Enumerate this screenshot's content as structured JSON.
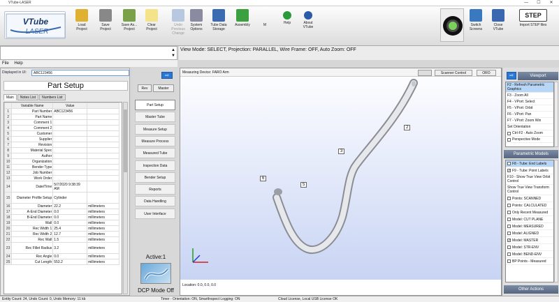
{
  "app": {
    "title": "VTube-LASER",
    "win_min": "—",
    "win_max": "☐",
    "win_close": "✕"
  },
  "logo": {
    "text": "VTube-LASER"
  },
  "toolbar": [
    {
      "label": "Load\nProject",
      "icon": "load-project-icon",
      "color": "#e0b030",
      "enabled": true
    },
    {
      "label": "Save\nProject",
      "icon": "save-project-icon",
      "color": "#888888",
      "enabled": true
    },
    {
      "label": "Save As...\nProject",
      "icon": "save-as-icon",
      "color": "#7aa04a",
      "enabled": true
    },
    {
      "label": "Clear\nProject",
      "icon": "clear-project-icon",
      "color": "#f4e38a",
      "enabled": true
    },
    {
      "label": "Undo\nPrevious\nChange",
      "icon": "undo-icon",
      "color": "#b8c8e0",
      "enabled": false
    },
    {
      "label": "System\nOptions",
      "icon": "gear-icon",
      "color": "#8a8aa0",
      "enabled": true
    },
    {
      "label": "Tube Data\nStorage",
      "icon": "tube-storage-icon",
      "color": "#3a6ab0",
      "enabled": true
    },
    {
      "label": "Assembly",
      "icon": "assembly-icon",
      "color": "#3aa040",
      "enabled": true
    },
    {
      "label": "M",
      "icon": "m-icon",
      "color": "#111111",
      "enabled": true
    },
    {
      "label": "Help",
      "icon": "help-icon",
      "color": "#2a9a3a",
      "enabled": true
    },
    {
      "label": "About\nVTube",
      "icon": "info-icon",
      "color": "#2a5aa8",
      "enabled": true
    }
  ],
  "toolbar_right": [
    {
      "label": "Switch\nScreens",
      "icon": "switch-screens-icon"
    },
    {
      "label": "Close\nVTube",
      "icon": "close-vtube-icon"
    },
    {
      "label": "Import STEP files",
      "icon": "step-import-icon",
      "badge": "STEP"
    }
  ],
  "viewmode": "View Mode: SELECT, Projection: PARALLEL, Wire Frame: OFF, Auto Zoom: OFF",
  "menu": {
    "file": "File",
    "help": "Help"
  },
  "left": {
    "displayed_label": "Displayed in UI:",
    "displayed_value": "ABC123456",
    "title": "Part Setup",
    "tabs": [
      "Main",
      "Notes List",
      "Numbers List"
    ],
    "grid_headers": [
      "Variable Name",
      "Value"
    ],
    "rows": [
      [
        "1",
        "Part Number",
        "ABC123456",
        ""
      ],
      [
        "2",
        "Part Name",
        "",
        ""
      ],
      [
        "3",
        "Comment 1",
        "",
        ""
      ],
      [
        "4",
        "Comment 2",
        "",
        ""
      ],
      [
        "5",
        "Customer",
        "",
        ""
      ],
      [
        "6",
        "Supplier",
        "",
        ""
      ],
      [
        "7",
        "Revision",
        "",
        ""
      ],
      [
        "8",
        "Material Spec",
        "",
        ""
      ],
      [
        "9",
        "Author",
        "",
        ""
      ],
      [
        "10",
        "Organization",
        "",
        ""
      ],
      [
        "11",
        "Bender Type",
        "",
        ""
      ],
      [
        "12",
        "Job Number",
        "",
        ""
      ],
      [
        "13",
        "Work Order",
        "",
        ""
      ],
      [
        "14",
        "Date/Time",
        "5/7/2020 9:38:39 AM",
        ""
      ],
      [
        "15",
        "Diameter Profile Setup",
        "Cylinder",
        ""
      ],
      [
        "16",
        "Diameter",
        "22.2",
        "millimeters"
      ],
      [
        "17",
        "A-End Diameter",
        "0.0",
        "millimeters"
      ],
      [
        "18",
        "B-End Diameter",
        "0.0",
        "millimeters"
      ],
      [
        "19",
        "Wall",
        "0.0",
        "millimeters"
      ],
      [
        "20",
        "Rec Width 1",
        "25.4",
        "millimeters"
      ],
      [
        "21",
        "Rec Width 2",
        "12.7",
        "millimeters"
      ],
      [
        "22",
        "Rec Wall",
        "1.5",
        "millimeters"
      ],
      [
        "23",
        "Rec Fillet Radius",
        "3.2",
        "millimeters"
      ],
      [
        "24",
        "Rec Angle",
        "0.0",
        "millimeters"
      ],
      [
        "25",
        "Cut Length",
        "553.2",
        "millimeters"
      ]
    ]
  },
  "mid": {
    "arrow": "⇨",
    "rev": "Rev",
    "master": "Master",
    "nav": [
      "Part Setup",
      "Master Tube",
      "Measure Setup",
      "Measure Process",
      "Measured Tube",
      "Inspection Data",
      "Bender Setup",
      "Reports",
      "Data Handling",
      "User Interface"
    ],
    "active": "Active:1",
    "dcp": "DCP Mode Off"
  },
  "viewport": {
    "device": "Measuring Device: FARO Arm",
    "scanner": "Scanner Control",
    "oro": "ORO",
    "location": "Location: 0.0, 0.0, 0.0",
    "labels": [
      "2",
      "3",
      "5",
      "6"
    ]
  },
  "right": {
    "viewport_title": "Viewport",
    "viewport_items": [
      "F2 - Refresh Parametric Graphics",
      "F3 - Zoom All",
      "F4 - VPort: Select",
      "F5 - VPort: Orbit",
      "F6 - VPort: Pan",
      "F7 - VPort: Zoom Win",
      "Set Orientation",
      "Ctrl-F2 - Auto Zoom",
      "Perspective Mode"
    ],
    "param_title": "Parametric Models",
    "param_items": [
      {
        "label": "F8 - Tube: End Labels",
        "checked": false,
        "sel": true
      },
      {
        "label": "F9 - Tube: Point Labels",
        "checked": true,
        "sel": false
      },
      {
        "label": "F10 - Show True View Orbit Control",
        "checked": false,
        "sel": false,
        "nobox": true
      },
      {
        "label": "Show True View Transform Control",
        "checked": false,
        "sel": false,
        "nobox": true
      },
      {
        "label": "Points: SCANNED",
        "checked": false,
        "sel": false
      },
      {
        "label": "Points: CALCULATED",
        "checked": false,
        "sel": false
      },
      {
        "label": "Only Recent Measured",
        "checked": false,
        "sel": false
      },
      {
        "label": "Model: CUT PLANE",
        "checked": false,
        "sel": false
      },
      {
        "label": "Model: MEASURED",
        "checked": false,
        "sel": false
      },
      {
        "label": "Model: ALIGNED",
        "checked": false,
        "sel": false
      },
      {
        "label": "Model: MASTER",
        "checked": true,
        "sel": false
      },
      {
        "label": "Model: STR-ENV",
        "checked": false,
        "sel": false
      },
      {
        "label": "Model: BEND-ENV",
        "checked": false,
        "sel": false
      },
      {
        "label": "BP Points - Measured",
        "checked": false,
        "sel": false
      }
    ],
    "other_title": "Other Actions"
  },
  "status": {
    "left": "Entity Count: 24, Undo Count: 0, Undo Memory: 11 kb",
    "mid": "Timer - Orientation: ON, SmartInspect Logging: ON",
    "right": "Cloud License, Local USB License OK"
  }
}
